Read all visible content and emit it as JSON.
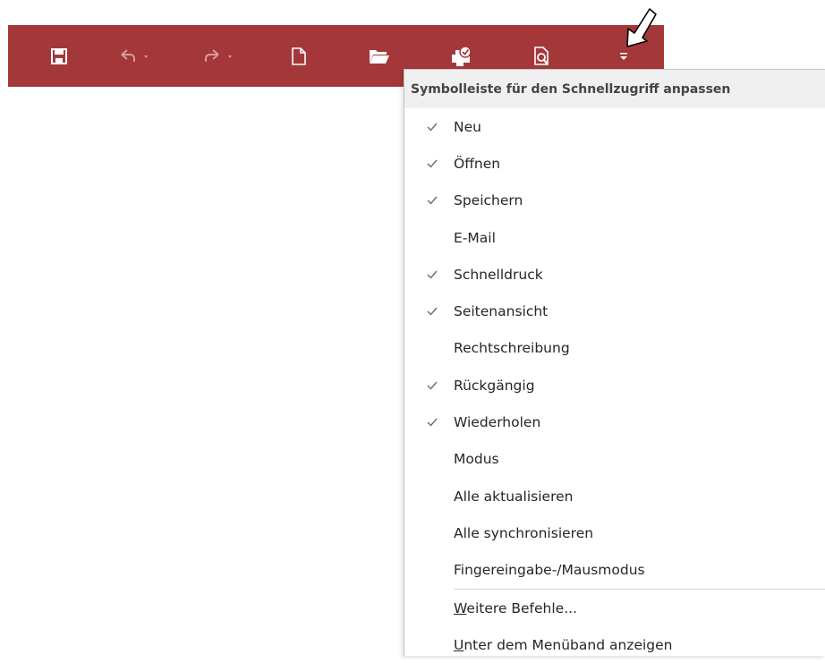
{
  "toolbar": {
    "buttons": [
      {
        "name": "save",
        "icon": "floppy-disk-icon",
        "enabled": true
      },
      {
        "name": "undo",
        "icon": "undo-icon",
        "enabled": false
      },
      {
        "name": "redo",
        "icon": "redo-icon",
        "enabled": false
      },
      {
        "name": "new",
        "icon": "new-document-icon",
        "enabled": true
      },
      {
        "name": "open",
        "icon": "folder-open-icon",
        "enabled": true
      },
      {
        "name": "quick-print",
        "icon": "quick-print-icon",
        "enabled": true
      },
      {
        "name": "print-preview",
        "icon": "print-preview-icon",
        "enabled": true
      },
      {
        "name": "customize",
        "icon": "customize-dropdown-icon",
        "enabled": true
      }
    ],
    "colors": {
      "background": "#a4373a",
      "icon": "#ffffff",
      "disabled_icon": "#d59b9c"
    }
  },
  "menu": {
    "title": "Symbolleiste für den Schnellzugriff anpassen",
    "items": [
      {
        "label": "Neu",
        "checked": true
      },
      {
        "label": "Öffnen",
        "checked": true
      },
      {
        "label": "Speichern",
        "checked": true
      },
      {
        "label": "E-Mail",
        "checked": false
      },
      {
        "label": "Schnelldruck",
        "checked": true
      },
      {
        "label": "Seitenansicht",
        "checked": true
      },
      {
        "label": "Rechtschreibung",
        "checked": false
      },
      {
        "label": "Rückgängig",
        "checked": true
      },
      {
        "label": "Wiederholen",
        "checked": true
      },
      {
        "label": "Modus",
        "checked": false
      },
      {
        "label": "Alle aktualisieren",
        "checked": false
      },
      {
        "label": "Alle synchronisieren",
        "checked": false
      },
      {
        "label": "Fingereingabe-/Mausmodus",
        "checked": false
      }
    ],
    "more_commands": {
      "accel": "W",
      "rest": "eitere Befehle..."
    },
    "show_below": {
      "accel": "U",
      "rest": "nter dem Menüband anzeigen"
    }
  }
}
